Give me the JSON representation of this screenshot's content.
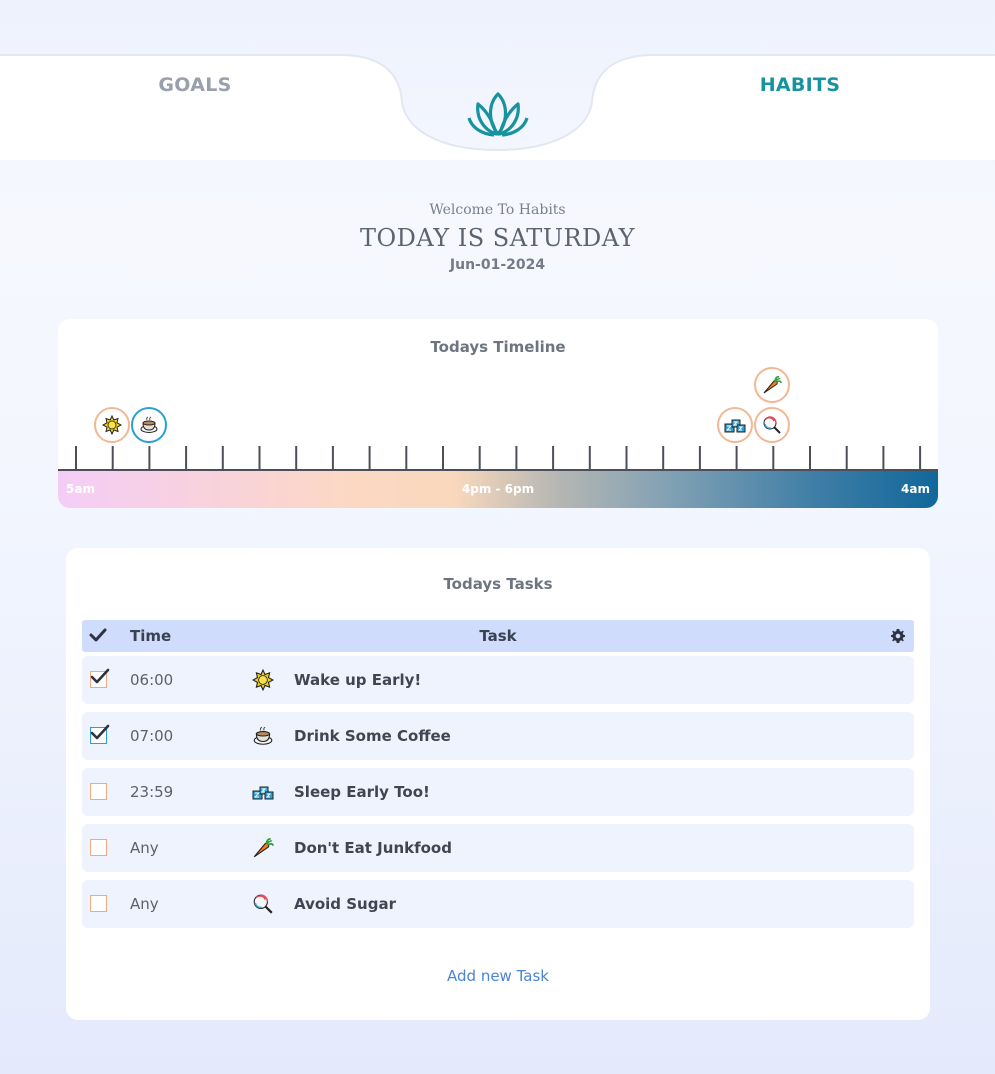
{
  "nav": {
    "goals_label": "GOALS",
    "habits_label": "HABITS",
    "active_tab": "HABITS",
    "logo_icon": "lotus-icon",
    "accent_color": "#17939f"
  },
  "header": {
    "welcome": "Welcome To Habits",
    "today": "TODAY IS SATURDAY",
    "date": "Jun-01-2024"
  },
  "timeline": {
    "title": "Todays Timeline",
    "start_label": "5am",
    "mid_label": "4pm - 6pm",
    "end_label": "4am",
    "markers": [
      {
        "icon": "sun-icon",
        "hour": "06:00",
        "done": true
      },
      {
        "icon": "coffee-icon",
        "hour": "07:00",
        "done": true
      },
      {
        "icon": "sleep-icon",
        "hour": "23:59",
        "done": false
      },
      {
        "icon": "carrot-icon",
        "hour": "Any",
        "done": false
      },
      {
        "icon": "lollipop-icon",
        "hour": "Any",
        "done": false
      }
    ]
  },
  "tasks": {
    "title": "Todays Tasks",
    "columns": {
      "time": "Time",
      "task": "Task"
    },
    "rows": [
      {
        "time": "06:00",
        "name": "Wake up Early!",
        "icon": "sun-icon",
        "done": true
      },
      {
        "time": "07:00",
        "name": "Drink Some Coffee",
        "icon": "coffee-icon",
        "done": true
      },
      {
        "time": "23:59",
        "name": "Sleep Early Too!",
        "icon": "sleep-icon",
        "done": false
      },
      {
        "time": "Any",
        "name": "Don't Eat Junkfood",
        "icon": "carrot-icon",
        "done": false
      },
      {
        "time": "Any",
        "name": "Avoid Sugar",
        "icon": "lollipop-icon",
        "done": false
      }
    ],
    "add_label": "Add new Task"
  }
}
